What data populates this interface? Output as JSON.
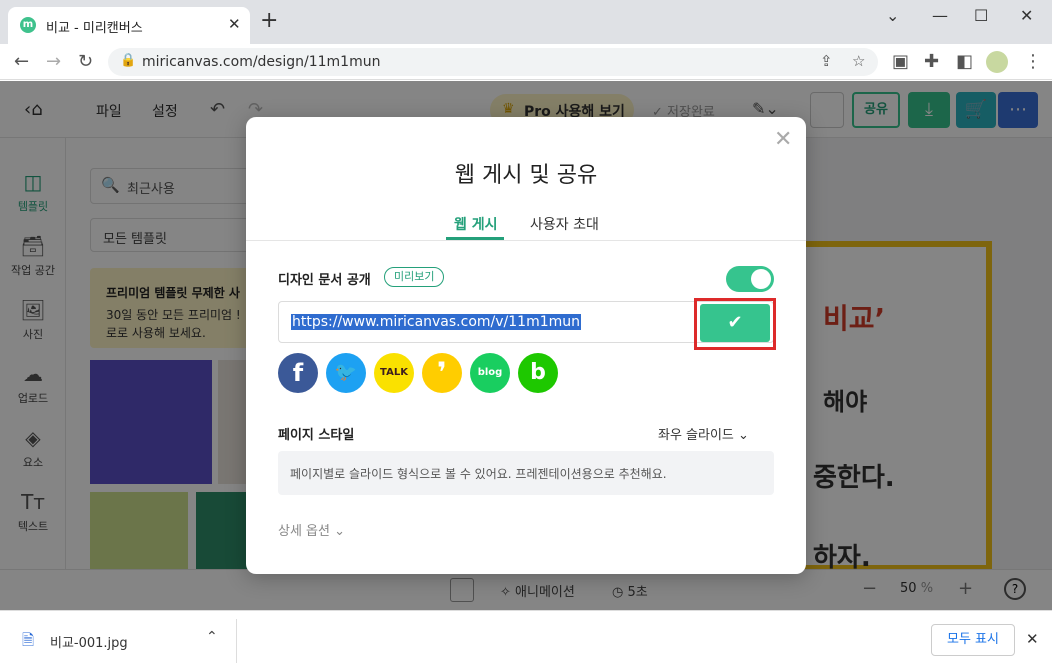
{
  "browser": {
    "tab_title": "비교 - 미리캔버스",
    "tab_favicon": "m",
    "url": "miricanvas.com/design/11m1mun"
  },
  "app": {
    "menu": {
      "file": "파일",
      "settings": "설정"
    },
    "pro_button": "Pro 사용해 보기",
    "saved_status": "저장완료",
    "share_button": "공유",
    "left_nav": [
      {
        "label": "템플릿"
      },
      {
        "label": "작업 공간"
      },
      {
        "label": "사진"
      },
      {
        "label": "업로드"
      },
      {
        "label": "요소"
      },
      {
        "label": "텍스트"
      }
    ],
    "panel": {
      "search_placeholder": "최근사용",
      "filter": "모든 템플릿",
      "promo_title": "프리미엄 템플릿 무제한 사",
      "promo_line1": "30일 동안 모든 프리미엄 !",
      "promo_line2": "로로 사용해 보세요."
    },
    "canvas_text": [
      "비교’",
      "해야",
      "중한다.",
      "하자."
    ],
    "bottom": {
      "animation": "애니메이션",
      "duration": "5초",
      "zoom": "50",
      "zoom_unit": "%"
    }
  },
  "modal": {
    "title": "웹 게시 및 공유",
    "tabs": [
      {
        "label": "웹 게시",
        "active": true
      },
      {
        "label": "사용자 초대",
        "active": false
      }
    ],
    "publish_label": "디자인 문서 공개",
    "preview_badge": "미리보기",
    "toggle_on": true,
    "share_url": "https://www.miricanvas.com/v/11m1mun",
    "social": [
      {
        "name": "facebook-icon",
        "glyph": "f",
        "color": "#3b5998"
      },
      {
        "name": "twitter-icon",
        "glyph": "🐦",
        "color": "#1da1f2"
      },
      {
        "name": "kakaotalk-icon",
        "glyph": "TALK",
        "color": "#fae100"
      },
      {
        "name": "kakaostory-icon",
        "glyph": "❜",
        "color": "#ffcd00"
      },
      {
        "name": "naver-blog-icon",
        "glyph": "blog",
        "color": "#19ce60"
      },
      {
        "name": "band-icon",
        "glyph": "b",
        "color": "#1ec800"
      }
    ],
    "page_style_label": "페이지 스타일",
    "page_style_value": "좌우 슬라이드",
    "page_style_desc": "페이지별로 슬라이드 형식으로 볼 수 있어요. 프레젠테이션용으로 추천해요.",
    "detail_options": "상세 옵션"
  },
  "download_bar": {
    "file_name": "비교-001.jpg",
    "show_all": "모두 표시"
  },
  "colors": {
    "accent": "#36c48e",
    "highlight_frame": "#dd2a2a"
  }
}
